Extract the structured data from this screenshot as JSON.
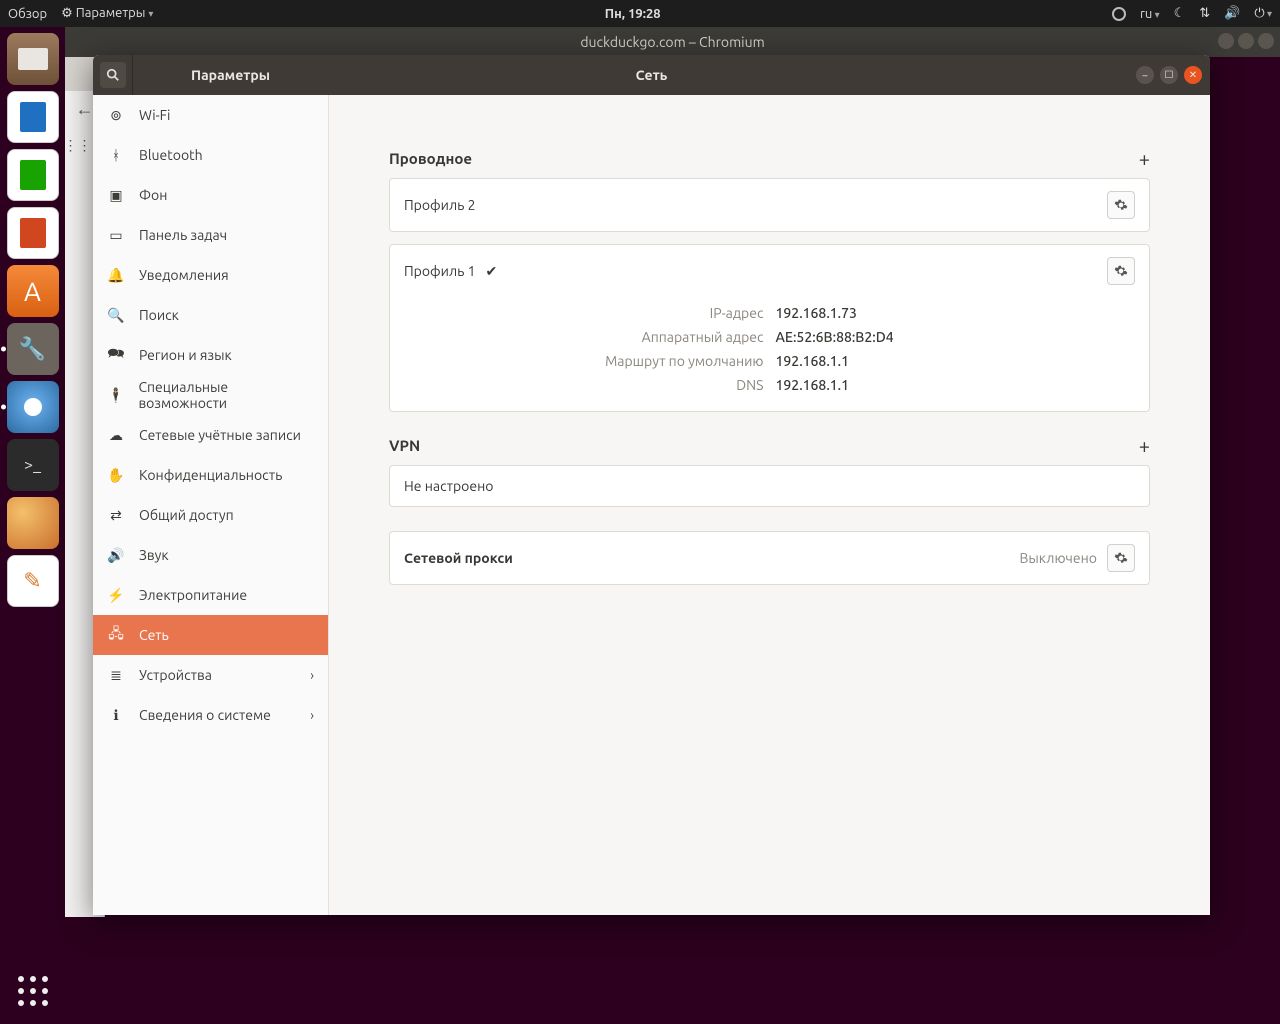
{
  "topbar": {
    "activities": "Обзор",
    "appmenu": "Параметры",
    "clock": "Пн, 19:28",
    "lang": "ru"
  },
  "chromium": {
    "title": "duckduckgo.com – Chromium"
  },
  "settings": {
    "app_title": "Параметры",
    "page_title": "Сеть",
    "sidebar": [
      {
        "icon": "wifi",
        "label": "Wi-Fi"
      },
      {
        "icon": "bt",
        "label": "Bluetooth"
      },
      {
        "icon": "bg",
        "label": "Фон"
      },
      {
        "icon": "panel",
        "label": "Панель задач"
      },
      {
        "icon": "notif",
        "label": "Уведомления"
      },
      {
        "icon": "search",
        "label": "Поиск"
      },
      {
        "icon": "region",
        "label": "Регион и язык"
      },
      {
        "icon": "a11y",
        "label": "Специальные возможности"
      },
      {
        "icon": "accounts",
        "label": "Сетевые учётные записи"
      },
      {
        "icon": "privacy",
        "label": "Конфиденциальность"
      },
      {
        "icon": "sharing",
        "label": "Общий доступ"
      },
      {
        "icon": "sound",
        "label": "Звук"
      },
      {
        "icon": "power",
        "label": "Электропитание"
      },
      {
        "icon": "network",
        "label": "Сеть",
        "active": true
      },
      {
        "icon": "devices",
        "label": "Устройства",
        "chevron": true
      },
      {
        "icon": "about",
        "label": "Сведения о системе",
        "chevron": true
      }
    ],
    "wired": {
      "heading": "Проводное",
      "profiles": [
        {
          "name": "Профиль 2"
        },
        {
          "name": "Профиль 1",
          "active": true,
          "details": [
            {
              "label": "IP-адрес",
              "value": "192.168.1.73"
            },
            {
              "label": "Аппаратный адрес",
              "value": "AE:52:6B:88:B2:D4"
            },
            {
              "label": "Маршрут по умолчанию",
              "value": "192.168.1.1"
            },
            {
              "label": "DNS",
              "value": "192.168.1.1"
            }
          ]
        }
      ]
    },
    "vpn": {
      "heading": "VPN",
      "empty": "Не настроено"
    },
    "proxy": {
      "title": "Сетевой прокси",
      "status": "Выключено"
    }
  }
}
